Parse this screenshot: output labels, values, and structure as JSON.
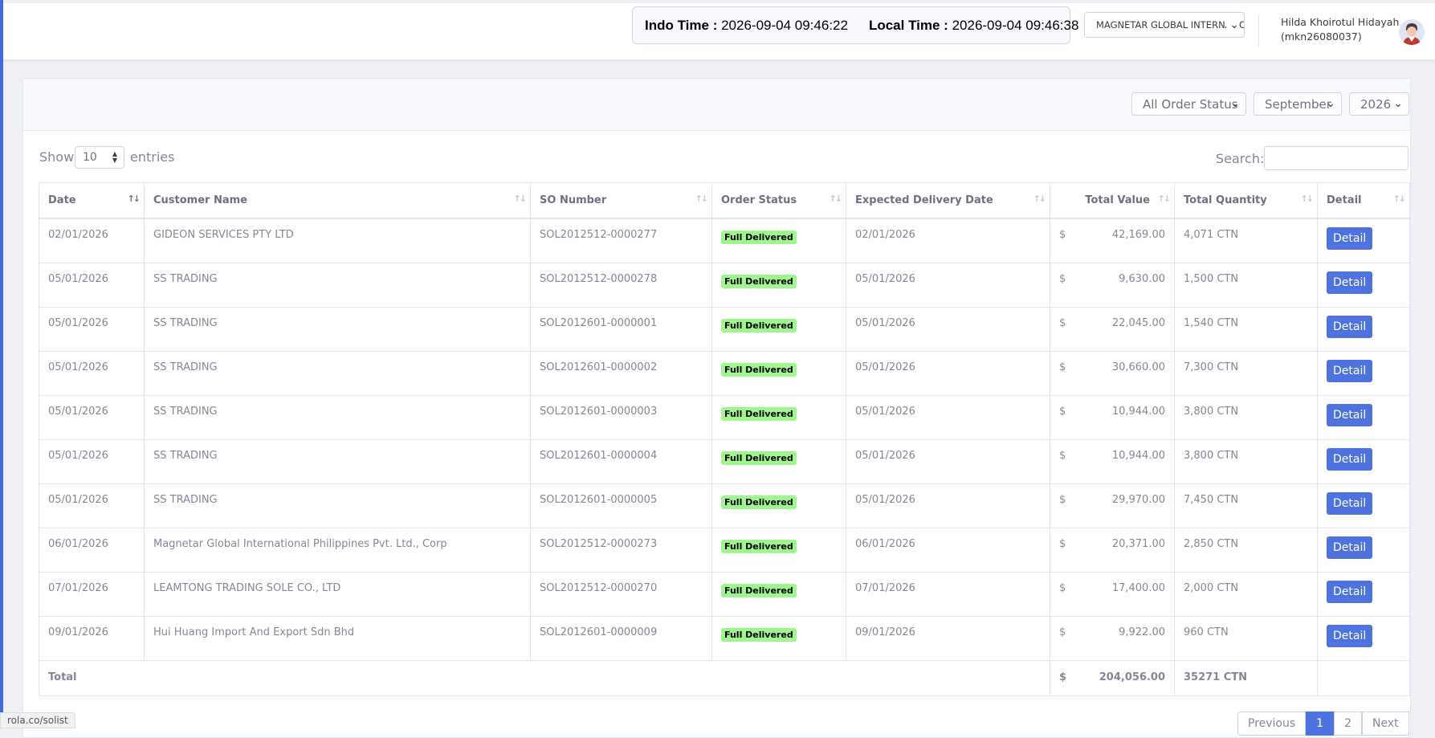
{
  "header": {
    "indo_time_label": "Indo Time :",
    "indo_time_value": "2026-09-04 09:46:22",
    "local_time_label": "Local Time :",
    "local_time_value": "2026-09-04 09:46:38",
    "company_select": "MAGNETAR GLOBAL INTERNATIONAL",
    "user_name": "Hilda Khoirotul Hidayah",
    "user_id": "(mkn26080037)"
  },
  "filters": {
    "order_status": "All Order Status",
    "month": "September",
    "year": "2026"
  },
  "table_controls": {
    "show_label": "Show",
    "entries_value": "10",
    "entries_label": "entries",
    "search_label": "Search:"
  },
  "columns": [
    "Date",
    "Customer Name",
    "SO Number",
    "Order Status",
    "Expected Delivery Date",
    "Total Value",
    "Total Quantity",
    "Detail"
  ],
  "rows": [
    {
      "date": "02/01/2026",
      "customer": "GIDEON SERVICES PTY LTD",
      "so": "SOL2012512-0000277",
      "status": "Full Delivered",
      "expected": "02/01/2026",
      "currency": "$",
      "value": "42,169.00",
      "qty": "4,071 CTN",
      "action": "Detail"
    },
    {
      "date": "05/01/2026",
      "customer": "SS TRADING",
      "so": "SOL2012512-0000278",
      "status": "Full Delivered",
      "expected": "05/01/2026",
      "currency": "$",
      "value": "9,630.00",
      "qty": "1,500 CTN",
      "action": "Detail"
    },
    {
      "date": "05/01/2026",
      "customer": "SS TRADING",
      "so": "SOL2012601-0000001",
      "status": "Full Delivered",
      "expected": "05/01/2026",
      "currency": "$",
      "value": "22,045.00",
      "qty": "1,540 CTN",
      "action": "Detail"
    },
    {
      "date": "05/01/2026",
      "customer": "SS TRADING",
      "so": "SOL2012601-0000002",
      "status": "Full Delivered",
      "expected": "05/01/2026",
      "currency": "$",
      "value": "30,660.00",
      "qty": "7,300 CTN",
      "action": "Detail"
    },
    {
      "date": "05/01/2026",
      "customer": "SS TRADING",
      "so": "SOL2012601-0000003",
      "status": "Full Delivered",
      "expected": "05/01/2026",
      "currency": "$",
      "value": "10,944.00",
      "qty": "3,800 CTN",
      "action": "Detail"
    },
    {
      "date": "05/01/2026",
      "customer": "SS TRADING",
      "so": "SOL2012601-0000004",
      "status": "Full Delivered",
      "expected": "05/01/2026",
      "currency": "$",
      "value": "10,944.00",
      "qty": "3,800 CTN",
      "action": "Detail"
    },
    {
      "date": "05/01/2026",
      "customer": "SS TRADING",
      "so": "SOL2012601-0000005",
      "status": "Full Delivered",
      "expected": "05/01/2026",
      "currency": "$",
      "value": "29,970.00",
      "qty": "7,450 CTN",
      "action": "Detail"
    },
    {
      "date": "06/01/2026",
      "customer": "Magnetar Global International Philippines Pvt. Ltd., Corp",
      "so": "SOL2012512-0000273",
      "status": "Full Delivered",
      "expected": "06/01/2026",
      "currency": "$",
      "value": "20,371.00",
      "qty": "2,850 CTN",
      "action": "Detail"
    },
    {
      "date": "07/01/2026",
      "customer": "LEAMTONG TRADING SOLE CO., LTD",
      "so": "SOL2012512-0000270",
      "status": "Full Delivered",
      "expected": "07/01/2026",
      "currency": "$",
      "value": "17,400.00",
      "qty": "2,000 CTN",
      "action": "Detail"
    },
    {
      "date": "09/01/2026",
      "customer": "Hui Huang Import And Export Sdn Bhd",
      "so": "SOL2012601-0000009",
      "status": "Full Delivered",
      "expected": "09/01/2026",
      "currency": "$",
      "value": "9,922.00",
      "qty": "960 CTN",
      "action": "Detail"
    }
  ],
  "total": {
    "label": "Total",
    "currency": "$",
    "value": "204,056.00",
    "qty": "35271 CTN"
  },
  "pagination": {
    "prev": "Previous",
    "pages": [
      "1",
      "2"
    ],
    "next": "Next"
  },
  "status_url": "rola.co/solist",
  "colors": {
    "accent": "#4e73df",
    "badge": "#9ff58e",
    "left_bar": "#4468e0"
  }
}
